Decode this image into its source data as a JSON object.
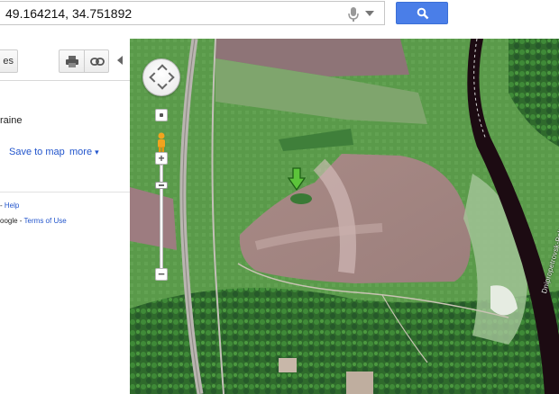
{
  "search": {
    "value": "49.164214, 34.751892"
  },
  "left_panel": {
    "tab_fragment": "es",
    "place_name_fragment": "raine",
    "save_to_map": "Save to map",
    "more": "more",
    "more_arrow": "▾",
    "help_prefix": "-",
    "help_link": "Help",
    "terms_prefix": "oogle -",
    "terms_link": "Terms of Use"
  },
  "map": {
    "road_label": "Dnipropetrovsk-Poltava"
  },
  "icons": {
    "mic": "microphone-icon",
    "dropdown": "chevron-down-icon",
    "search": "magnifier-icon",
    "print": "printer-icon",
    "link": "chain-link-icon",
    "collapse": "chevron-left-icon",
    "pegman": "pegman-icon",
    "marker": "green-arrow-marker-icon"
  },
  "colors": {
    "search_button": "#4a7ee8",
    "link": "#2255cc",
    "marker": "#5cc43a"
  }
}
